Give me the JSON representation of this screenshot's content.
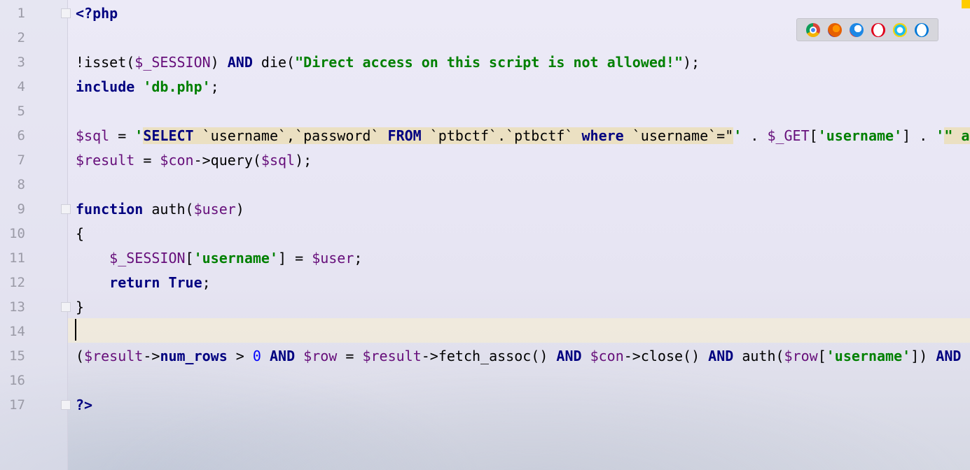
{
  "editor": {
    "line_numbers": [
      "1",
      "2",
      "3",
      "4",
      "5",
      "6",
      "7",
      "8",
      "9",
      "10",
      "11",
      "12",
      "13",
      "14",
      "15",
      "16",
      "17"
    ],
    "lines": [
      [
        {
          "t": "<?php",
          "c": "tag"
        }
      ],
      [],
      [
        {
          "t": "!isset(",
          "c": "f"
        },
        {
          "t": "$_SESSION",
          "c": "v"
        },
        {
          "t": ") ",
          "c": "p"
        },
        {
          "t": "AND",
          "c": "k"
        },
        {
          "t": " die(",
          "c": "f"
        },
        {
          "t": "\"Direct access on this script is not allowed!\"",
          "c": "s"
        },
        {
          "t": ");",
          "c": "p"
        }
      ],
      [
        {
          "t": "include",
          "c": "k"
        },
        {
          "t": " ",
          "c": "p"
        },
        {
          "t": "'db.php'",
          "c": "s"
        },
        {
          "t": ";",
          "c": "p"
        }
      ],
      [],
      [
        {
          "t": "$sql",
          "c": "v"
        },
        {
          "t": " = ",
          "c": "p"
        },
        {
          "t": "'",
          "c": "s"
        },
        {
          "t": "SELECT",
          "c": "k sqlbg"
        },
        {
          "t": " `username`,`password` ",
          "c": "p sqlbg"
        },
        {
          "t": "FROM",
          "c": "k sqlbg"
        },
        {
          "t": " `ptbctf`.`ptbctf` ",
          "c": "p sqlbg"
        },
        {
          "t": "where",
          "c": "k sqlbg"
        },
        {
          "t": " `username`=\"",
          "c": "p sqlbg"
        },
        {
          "t": "'",
          "c": "s"
        },
        {
          "t": " . ",
          "c": "p"
        },
        {
          "t": "$_GET",
          "c": "v"
        },
        {
          "t": "[",
          "c": "p"
        },
        {
          "t": "'username'",
          "c": "s"
        },
        {
          "t": "] . ",
          "c": "p"
        },
        {
          "t": "'",
          "c": "s"
        },
        {
          "t": "\" an",
          "c": "s sqlbg"
        }
      ],
      [
        {
          "t": "$result",
          "c": "v"
        },
        {
          "t": " = ",
          "c": "p"
        },
        {
          "t": "$con",
          "c": "v"
        },
        {
          "t": "->query(",
          "c": "f"
        },
        {
          "t": "$sql",
          "c": "v"
        },
        {
          "t": ");",
          "c": "p"
        }
      ],
      [],
      [
        {
          "t": "function",
          "c": "k"
        },
        {
          "t": " auth(",
          "c": "f"
        },
        {
          "t": "$user",
          "c": "v"
        },
        {
          "t": ")",
          "c": "p"
        }
      ],
      [
        {
          "t": "{",
          "c": "p"
        }
      ],
      [
        {
          "t": "    ",
          "c": "p"
        },
        {
          "t": "$_SESSION",
          "c": "v"
        },
        {
          "t": "[",
          "c": "p"
        },
        {
          "t": "'username'",
          "c": "s"
        },
        {
          "t": "] = ",
          "c": "p"
        },
        {
          "t": "$user",
          "c": "v"
        },
        {
          "t": ";",
          "c": "p"
        }
      ],
      [
        {
          "t": "    ",
          "c": "p"
        },
        {
          "t": "return",
          "c": "k"
        },
        {
          "t": " ",
          "c": "p"
        },
        {
          "t": "True",
          "c": "k"
        },
        {
          "t": ";",
          "c": "p"
        }
      ],
      [
        {
          "t": "}",
          "c": "p"
        }
      ],
      [],
      [
        {
          "t": "(",
          "c": "p"
        },
        {
          "t": "$result",
          "c": "v"
        },
        {
          "t": "->",
          "c": "p"
        },
        {
          "t": "num_rows",
          "c": "k"
        },
        {
          "t": " > ",
          "c": "p"
        },
        {
          "t": "0",
          "c": "n"
        },
        {
          "t": " ",
          "c": "p"
        },
        {
          "t": "AND",
          "c": "k"
        },
        {
          "t": " ",
          "c": "p"
        },
        {
          "t": "$row",
          "c": "v"
        },
        {
          "t": " = ",
          "c": "p"
        },
        {
          "t": "$result",
          "c": "v"
        },
        {
          "t": "->fetch_assoc() ",
          "c": "f"
        },
        {
          "t": "AND",
          "c": "k"
        },
        {
          "t": " ",
          "c": "p"
        },
        {
          "t": "$con",
          "c": "v"
        },
        {
          "t": "->close() ",
          "c": "f"
        },
        {
          "t": "AND",
          "c": "k"
        },
        {
          "t": " auth(",
          "c": "f"
        },
        {
          "t": "$row",
          "c": "v"
        },
        {
          "t": "[",
          "c": "p"
        },
        {
          "t": "'username'",
          "c": "s"
        },
        {
          "t": "]) ",
          "c": "p"
        },
        {
          "t": "AND",
          "c": "k"
        },
        {
          "t": " d",
          "c": "f"
        }
      ],
      [],
      [
        {
          "t": "?>",
          "c": "tag"
        }
      ]
    ]
  },
  "browsers": [
    {
      "icon": "chrome-icon",
      "colors": [
        "#db4437",
        "#f4b400",
        "#0f9d58",
        "#4285f4"
      ]
    },
    {
      "icon": "firefox-icon",
      "colors": [
        "#e66000",
        "#ff9500",
        "#5b2a86"
      ]
    },
    {
      "icon": "safari-icon",
      "colors": [
        "#1e88e5",
        "#ffffff",
        "#e53935"
      ]
    },
    {
      "icon": "opera-icon",
      "colors": [
        "#e0001a"
      ]
    },
    {
      "icon": "ie-icon",
      "colors": [
        "#1ebbee",
        "#ffd600"
      ]
    },
    {
      "icon": "edge-icon",
      "colors": [
        "#0078d7"
      ]
    }
  ]
}
